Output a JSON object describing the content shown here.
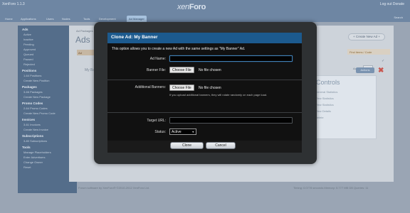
{
  "header": {
    "version": "XenForo 1.1.3",
    "logo_main": "xen",
    "logo_bold": "Foro",
    "user_links": "Log out Donate"
  },
  "nav": {
    "tabs": [
      "Home",
      "Applications",
      "Users",
      "Nodes",
      "Tools",
      "Development",
      "Ad Manager"
    ],
    "active_index": 6,
    "search": "Search"
  },
  "sidebar": {
    "sections": [
      {
        "head": "Ads",
        "items": [
          "Active",
          "Inactive",
          "Pending",
          "Approved",
          "Queued",
          "Paused",
          "Rejected"
        ]
      },
      {
        "head": "Positions",
        "items": [
          "1-64 Positions",
          "Create New Position"
        ]
      },
      {
        "head": "Packages",
        "items": [
          "3-66 Packages",
          "Create New Package"
        ]
      },
      {
        "head": "Promo Codes",
        "items": [
          "2-64 Promo Codes",
          "Create New Promo Code"
        ]
      },
      {
        "head": "Invoices",
        "items": [
          "3-61 Invoices",
          "Create New Invoice"
        ]
      },
      {
        "head": "Subscriptions",
        "items": [
          "3-80 Subscriptions"
        ]
      },
      {
        "head": "Tools",
        "items": [
          "Manage Placeholders",
          "Enter Advertisers",
          "Change Owner",
          "Reset"
        ]
      }
    ]
  },
  "background": {
    "breadcrumb": "Ad Packages",
    "title": "Ads",
    "new_ad_button": "+ Create New Ad +",
    "tab": "Ad",
    "row_label": "My Banner",
    "filter_label": "Find items / Code",
    "active_label": "Active",
    "checkmark": "✓",
    "controls_title": "Controls",
    "controls_items": [
      "General Statistics",
      "View Statistics",
      "View Statistics",
      "View Details",
      "Delete"
    ],
    "action_button": "Actions",
    "close_x": "✖",
    "footer_left": "Forum software by XenForo® ©2010-2012 XenForo Ltd.",
    "footer_right": "Timing: 0.0778 seconds Memory: 5.777 MB DB Queries: 11"
  },
  "modal": {
    "title": "Clone Ad: My Banner",
    "intro": "This option allows you to create a new Ad with the same settings as \"My Banner\" Ad.",
    "ad_name_label": "Ad Name:",
    "ad_name_value": "",
    "banner_file_label": "Banner File:",
    "choose_file": "Choose File",
    "no_file": "No file chosen",
    "additional_banners_label": "Additional Banners:",
    "additional_hint": "If you upload additional banners, they will rotate randomly on each page load.",
    "target_url_label": "Target URL:",
    "target_url_value": "",
    "status_label": "Status:",
    "status_value": "Active",
    "clone_button": "Clone",
    "cancel_button": "Cancel"
  },
  "colors": {
    "modal_title_bg": "#1c5a8e",
    "header_bg": "#6e86a3",
    "sidebar_bg": "#546d8a"
  }
}
